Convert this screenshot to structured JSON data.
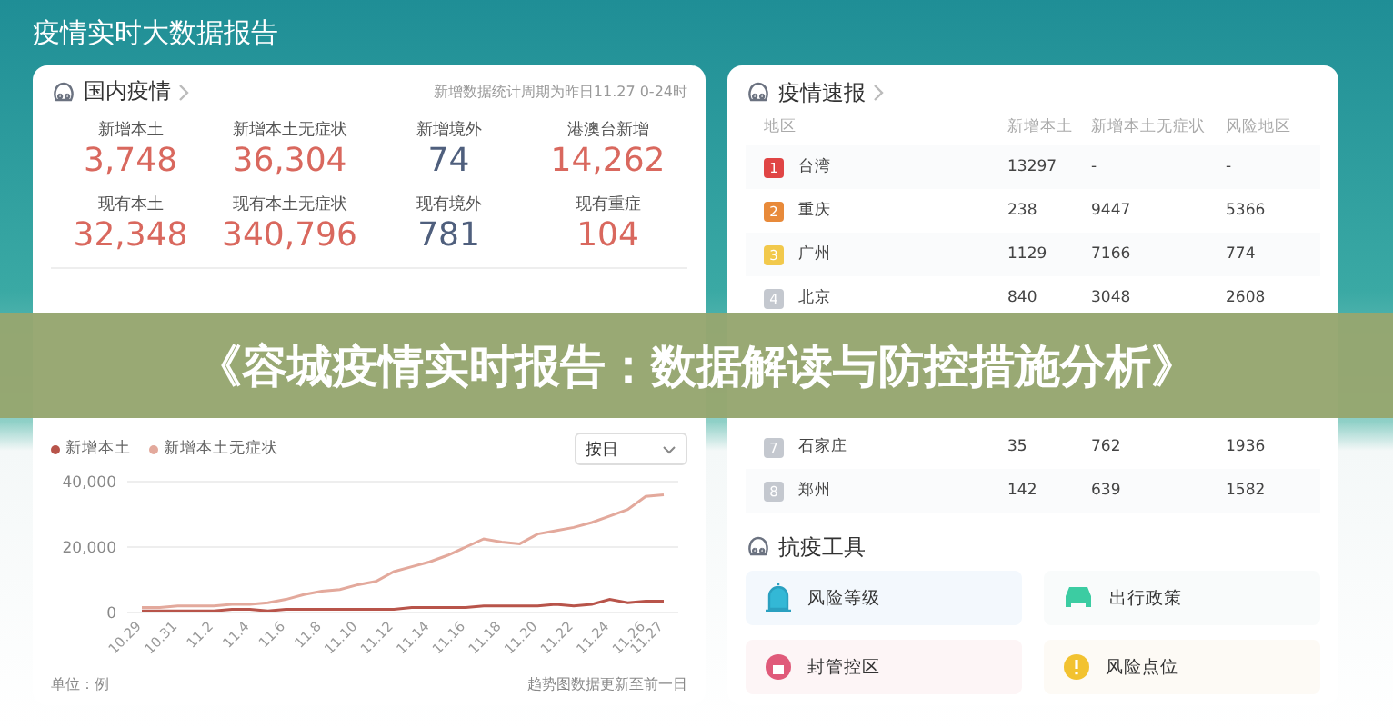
{
  "page_title": "疫情实时大数据报告",
  "domestic": {
    "title": "国内疫情",
    "note": "新增数据统计周期为昨日11.27 0-24时",
    "stats": [
      {
        "label": "新增本土",
        "value": "3,748",
        "color": "#d9685e"
      },
      {
        "label": "新增本土无症状",
        "value": "36,304",
        "color": "#d9685e"
      },
      {
        "label": "新增境外",
        "value": "74",
        "color": "#4f5f7d"
      },
      {
        "label": "港澳台新增",
        "value": "14,262",
        "color": "#d9685e"
      },
      {
        "label": "现有本土",
        "value": "32,348",
        "color": "#d9685e"
      },
      {
        "label": "现有本土无症状",
        "value": "340,796",
        "color": "#d9685e"
      },
      {
        "label": "现有境外",
        "value": "781",
        "color": "#4f5f7d"
      },
      {
        "label": "现有重症",
        "value": "104",
        "color": "#d9685e"
      }
    ]
  },
  "trend": {
    "dropdown": "按日",
    "unit": "单位：例",
    "footnote": "趋势图数据更新至前一日",
    "chart_data": {
      "type": "line",
      "categories": [
        "10.29",
        null,
        "10.31",
        null,
        "11.2",
        null,
        "11.4",
        null,
        "11.6",
        null,
        "11.8",
        null,
        "11.10",
        null,
        "11.12",
        null,
        "11.14",
        null,
        "11.16",
        null,
        "11.18",
        null,
        "11.20",
        null,
        "11.22",
        null,
        "11.24",
        null,
        "11.26",
        "11.27"
      ],
      "yticks": [
        {
          "value": 0,
          "label": "0"
        },
        {
          "value": 20000,
          "label": "20,000"
        },
        {
          "value": 40000,
          "label": "40,000"
        }
      ],
      "ylim": [
        0,
        40000
      ],
      "series": [
        {
          "name": "新增本土",
          "color": "#b8544a",
          "values": [
            500,
            500,
            500,
            500,
            500,
            1000,
            1000,
            500,
            1000,
            1000,
            1000,
            1000,
            1000,
            1000,
            1000,
            1500,
            1500,
            1500,
            1500,
            2000,
            2000,
            2000,
            2000,
            2500,
            2000,
            2500,
            4000,
            3000,
            3500,
            3500
          ]
        },
        {
          "name": "新增本土无症状",
          "color": "#e3a99c",
          "values": [
            1500,
            1500,
            2000,
            2000,
            2000,
            2500,
            2500,
            3000,
            4000,
            5500,
            6500,
            7000,
            8500,
            9500,
            12500,
            14000,
            15500,
            17500,
            20000,
            22500,
            21500,
            21000,
            24000,
            25000,
            26000,
            27500,
            29500,
            31500,
            35500,
            36000
          ]
        }
      ]
    }
  },
  "region_table": {
    "title": "疫情速报",
    "columns": [
      "地区",
      "新增本土",
      "新增本土无症状",
      "风险地区"
    ],
    "rows": [
      {
        "rank": "1",
        "color": "#e04545",
        "cells": [
          "台湾",
          "13297",
          "-",
          "-"
        ]
      },
      {
        "rank": "2",
        "color": "#e88a3a",
        "cells": [
          "重庆",
          "238",
          "9447",
          "5366"
        ]
      },
      {
        "rank": "3",
        "color": "#f2c94c",
        "cells": [
          "广州",
          "1129",
          "7166",
          "774"
        ]
      },
      {
        "rank": "4",
        "color": "#c4c8cf",
        "cells": [
          "北京",
          "840",
          "3048",
          "2608"
        ]
      },
      {
        "rank": "7",
        "color": "#c4c8cf",
        "cells": [
          "石家庄",
          "35",
          "762",
          "1936"
        ]
      },
      {
        "rank": "8",
        "color": "#c4c8cf",
        "cells": [
          "郑州",
          "142",
          "639",
          "1582"
        ]
      }
    ]
  },
  "tools": {
    "title": "抗疫工具",
    "items": [
      {
        "label": "风险等级",
        "kind": "alarm",
        "color": "#f3f8fd"
      },
      {
        "label": "出行政策",
        "kind": "car",
        "color": "#f9fbfb"
      },
      {
        "label": "封管控区",
        "kind": "lock",
        "color": "#fdf5f6"
      },
      {
        "label": "风险点位",
        "kind": "warning",
        "color": "#fdfaf5"
      }
    ]
  },
  "banner": "《容城疫情实时报告：数据解读与防控措施分析》"
}
